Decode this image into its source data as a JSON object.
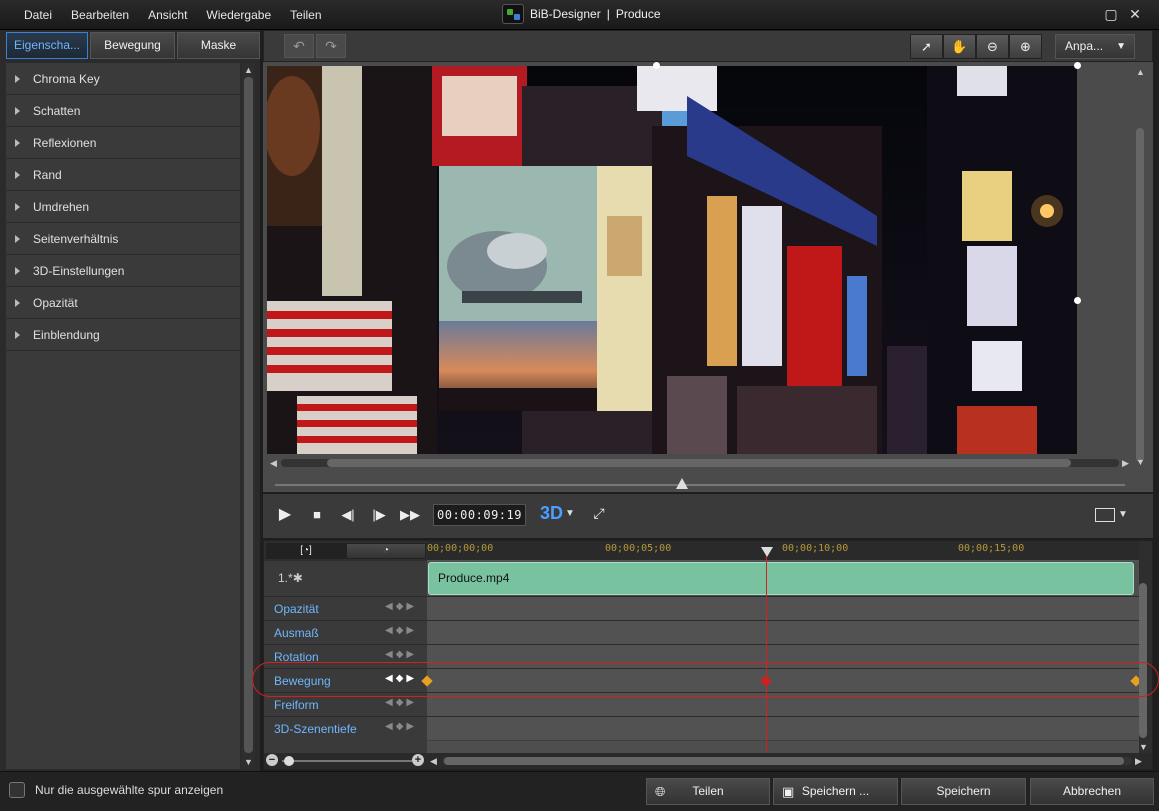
{
  "menu": [
    "Datei",
    "Bearbeiten",
    "Ansicht",
    "Wiedergabe",
    "Teilen"
  ],
  "window": {
    "app_name": "BiB-Designer",
    "separator": "|",
    "document": "Produce"
  },
  "left_tabs": [
    "Eigenscha...",
    "Bewegung",
    "Maske"
  ],
  "properties": [
    "Chroma Key",
    "Schatten",
    "Reflexionen",
    "Rand",
    "Umdrehen",
    "Seitenverhältnis",
    "3D-Einstellungen",
    "Opazität",
    "Einblendung"
  ],
  "toolbar": {
    "fit_label": "Anpa..."
  },
  "playback": {
    "timecode": "00:00:09:19",
    "mode_3d": "3D"
  },
  "timeline": {
    "ruler": [
      "00;00;00;00",
      "00;00;05;00",
      "00;00;10;00",
      "00;00;15;00"
    ],
    "track_number": "1.*",
    "clip_name": "Produce.mp4",
    "keyframe_rows": [
      "Opazität",
      "Ausmaß",
      "Rotation",
      "Bewegung",
      "Freiform",
      "3D-Szenentiefe"
    ],
    "active_row": "Bewegung"
  },
  "footer": {
    "only_selected_label": "Nur die ausgewählte spur anzeigen",
    "share_label": "Teilen",
    "save_as_label": "Speichern ...",
    "save_label": "Speichern",
    "cancel_label": "Abbrechen"
  },
  "colors": {
    "accent": "#3a7fd8",
    "clip": "#78c2a0",
    "playhead": "#d02020",
    "keyframe": "#e8a020"
  }
}
